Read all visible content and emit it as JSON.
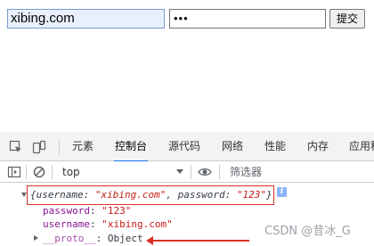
{
  "form": {
    "username_value": "xibing.com",
    "password_value": "•••",
    "submit_label": "提交"
  },
  "devtools": {
    "tabs": [
      {
        "label": "元素"
      },
      {
        "label": "控制台",
        "active": true
      },
      {
        "label": "源代码"
      },
      {
        "label": "网络"
      },
      {
        "label": "性能"
      },
      {
        "label": "内存"
      },
      {
        "label": "应用程"
      }
    ],
    "icons": [
      "inspect-icon",
      "device-toolbar-icon"
    ]
  },
  "console_toolbar": {
    "context_value": "top",
    "filter_placeholder": "筛选器",
    "icons": [
      "sidebar-toggle-icon",
      "clear-console-icon",
      "eye-icon"
    ]
  },
  "console_output": {
    "summary": {
      "open": "{",
      "k1": "username",
      "v1": "\"xibing.com\"",
      "sep": ", ",
      "k2": "password",
      "v2": "\"123\"",
      "close": "}",
      "colon": ": "
    },
    "info_glyph": "i",
    "properties": [
      {
        "key": "password",
        "value": "\"123\""
      },
      {
        "key": "username",
        "value": "\"xibing.com\""
      }
    ],
    "proto": {
      "key": "__proto__",
      "value": "Object"
    }
  },
  "watermark": "CSDN @昔冰_G",
  "colors": {
    "key": "#881391",
    "string": "#c41a16",
    "annotation_red": "#d93025",
    "accent_blue": "#1a73e8",
    "autofill_bg": "#e8f0fe"
  }
}
